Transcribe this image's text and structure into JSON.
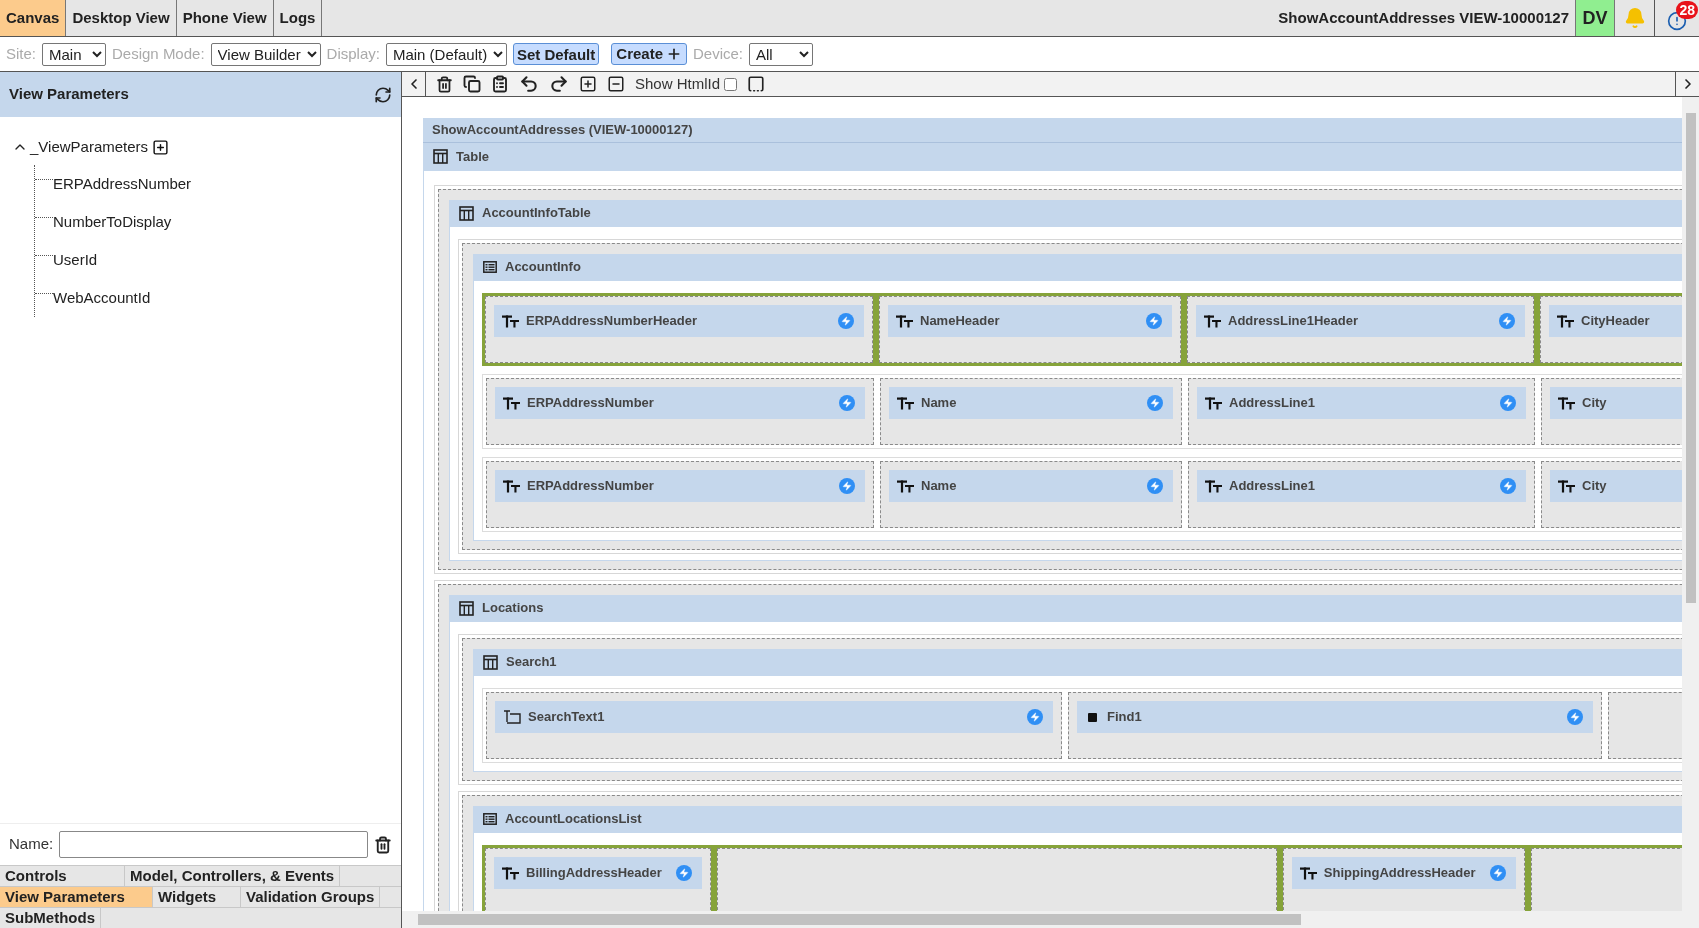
{
  "top_tabs": [
    {
      "label": "Canvas",
      "selected": true
    },
    {
      "label": "Desktop View",
      "selected": false
    },
    {
      "label": "Phone View",
      "selected": false
    },
    {
      "label": "Logs",
      "selected": false
    }
  ],
  "header": {
    "view_title": "ShowAccountAddresses VIEW-10000127",
    "user_initials": "DV",
    "alert_count": "28"
  },
  "toolbar": [
    {
      "kind": "select",
      "label": "Site:",
      "value": "Main"
    },
    {
      "kind": "select",
      "label": "Design Mode:",
      "value": "View Builder"
    },
    {
      "kind": "select",
      "label": "Display:",
      "value": "Main (Default)"
    },
    {
      "kind": "button",
      "label": "Set Default"
    },
    {
      "kind": "button-plus",
      "label": "Create"
    },
    {
      "kind": "select",
      "label": "Device:",
      "value": "All"
    }
  ],
  "canvas_toolbar": {
    "show_htmlid": {
      "label": "Show HtmlId",
      "checked": false
    }
  },
  "left_panel": {
    "title": "View Parameters",
    "tree": [
      {
        "label": "_ViewParameters",
        "expanded": true,
        "children": [
          {
            "label": "ERPAddressNumber"
          },
          {
            "label": "NumberToDisplay"
          },
          {
            "label": "UserId"
          },
          {
            "label": "WebAccountId"
          }
        ]
      }
    ],
    "name_label": "Name:"
  },
  "bottom_tabs": [
    [
      {
        "label": "Controls",
        "selected": false
      },
      {
        "label": "Model, Controllers, & Events",
        "selected": false
      }
    ],
    [
      {
        "label": "View Parameters",
        "selected": true
      },
      {
        "label": "Widgets",
        "selected": false
      },
      {
        "label": "Validation Groups",
        "selected": false
      }
    ],
    [
      {
        "label": "SubMethods",
        "selected": false
      }
    ]
  ],
  "canvas": {
    "title": "ShowAccountAddresses (VIEW-10000127)",
    "root": {
      "label": "Table",
      "kind": "table"
    },
    "sections": [
      {
        "label": "AccountInfoTable",
        "kind": "table",
        "children": [
          {
            "label": "AccountInfo",
            "kind": "list",
            "rows": [
              {
                "header": true,
                "cells": [
                  {
                    "kind": "text",
                    "label": "ERPAddressNumberHeader",
                    "event": true
                  },
                  {
                    "kind": "text",
                    "label": "NameHeader",
                    "event": true
                  },
                  {
                    "kind": "text",
                    "label": "AddressLine1Header",
                    "event": true
                  },
                  {
                    "kind": "text",
                    "label": "CityHeader",
                    "event": false
                  }
                ]
              },
              {
                "header": false,
                "cells": [
                  {
                    "kind": "text",
                    "label": "ERPAddressNumber",
                    "event": true
                  },
                  {
                    "kind": "text",
                    "label": "Name",
                    "event": true
                  },
                  {
                    "kind": "text",
                    "label": "AddressLine1",
                    "event": true
                  },
                  {
                    "kind": "text",
                    "label": "City",
                    "event": false
                  }
                ]
              },
              {
                "header": false,
                "cells": [
                  {
                    "kind": "text",
                    "label": "ERPAddressNumber",
                    "event": true
                  },
                  {
                    "kind": "text",
                    "label": "Name",
                    "event": true
                  },
                  {
                    "kind": "text",
                    "label": "AddressLine1",
                    "event": true
                  },
                  {
                    "kind": "text",
                    "label": "City",
                    "event": false
                  }
                ]
              }
            ]
          }
        ]
      },
      {
        "label": "Locations",
        "kind": "table",
        "children": [
          {
            "label": "Search1",
            "kind": "table",
            "rows": [
              {
                "header": false,
                "cells": [
                  {
                    "kind": "textbox",
                    "label": "SearchText1",
                    "event": true
                  },
                  {
                    "kind": "button",
                    "label": "Find1",
                    "event": true
                  },
                  {
                    "kind": "empty"
                  }
                ]
              }
            ]
          },
          {
            "label": "AccountLocationsList",
            "kind": "list",
            "rows": [
              {
                "header": true,
                "cells": [
                  {
                    "kind": "text",
                    "label": "BillingAddressHeader",
                    "event": true
                  },
                  {
                    "kind": "empty"
                  },
                  {
                    "kind": "text",
                    "label": "ShippingAddressHeader",
                    "event": true
                  },
                  {
                    "kind": "empty"
                  }
                ]
              }
            ]
          }
        ]
      }
    ]
  }
}
